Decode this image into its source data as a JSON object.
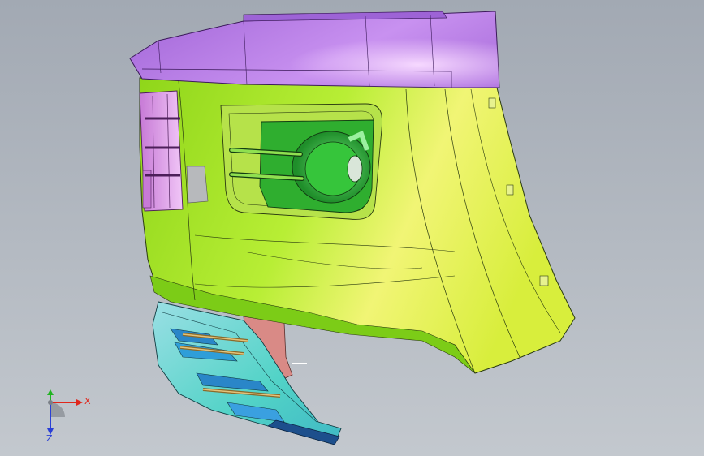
{
  "viewport": {
    "background_top": "#a2a9b3",
    "background_bottom": "#c3c8ce"
  },
  "model": {
    "parts": [
      {
        "name": "top-cap",
        "color": "#b77ee6"
      },
      {
        "name": "main-bumper-body",
        "color": "#aee62a"
      },
      {
        "name": "fog-lamp-housing",
        "color": "#2fae2f"
      },
      {
        "name": "side-vent-grille",
        "color": "#e6a6f0"
      },
      {
        "name": "lower-grille-insert",
        "color": "#63d7d0"
      },
      {
        "name": "support-bracket",
        "color": "#d98a86"
      }
    ]
  },
  "triad": {
    "x_label": "X",
    "y_label": "Y",
    "z_label": "Z",
    "x_color": "#e0261b",
    "y_color": "#21b321",
    "z_color": "#2a3fd6"
  }
}
